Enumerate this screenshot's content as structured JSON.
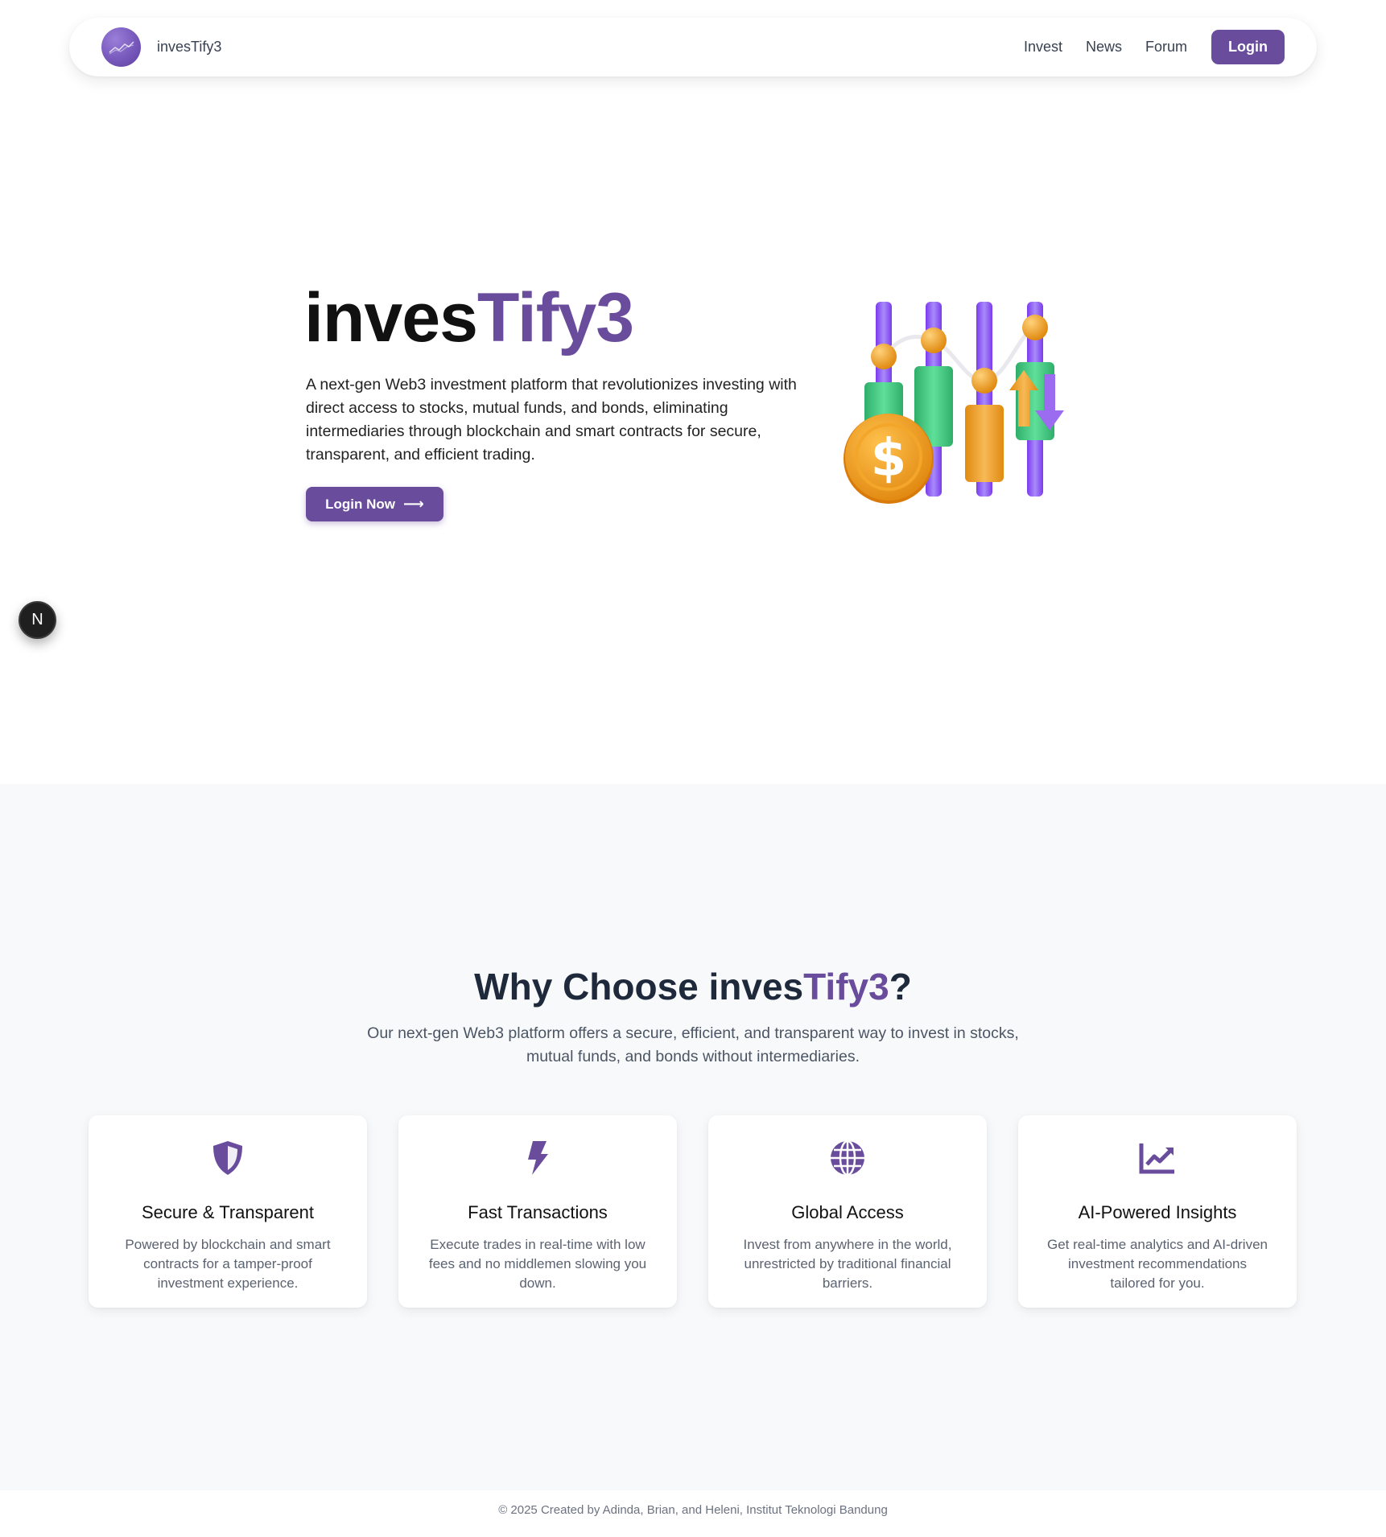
{
  "nav": {
    "brand": "invesTify3",
    "links": [
      "Invest",
      "News",
      "Forum"
    ],
    "login_label": "Login"
  },
  "hero": {
    "title_plain": "inves",
    "title_accent": "Tify3",
    "description": "A next-gen Web3 investment platform that revolutionizes investing with direct access to stocks, mutual funds, and bonds, eliminating intermediaries through blockchain and smart contracts for secure, transparent, and efficient trading.",
    "cta_label": "Login Now",
    "cta_icon": "arrow-right-icon",
    "illustration_icon": "stock-chart-coin-illustration"
  },
  "floating_badge": {
    "label": "N"
  },
  "features": {
    "title_bold": "Why Choose ",
    "title_plain": "inves",
    "title_accent": "Tify3",
    "title_end": "?",
    "subtitle": "Our next-gen Web3 platform offers a secure, efficient, and transparent way to invest in stocks, mutual funds, and bonds without intermediaries.",
    "cards": [
      {
        "icon": "shield-icon",
        "title": "Secure & Transparent",
        "description": "Powered by blockchain and smart contracts for a tamper-proof investment experience."
      },
      {
        "icon": "lightning-icon",
        "title": "Fast Transactions",
        "description": "Execute trades in real-time with low fees and no middlemen slowing you down."
      },
      {
        "icon": "globe-icon",
        "title": "Global Access",
        "description": "Invest from anywhere in the world, unrestricted by traditional financial barriers."
      },
      {
        "icon": "chart-line-icon",
        "title": "AI-Powered Insights",
        "description": "Get real-time analytics and AI-driven investment recommendations tailored for you."
      }
    ]
  },
  "footer": {
    "text": "© 2025 Created by Adinda, Brian, and Heleni, Institut Teknologi Bandung"
  },
  "colors": {
    "accent": "#6a4c9c",
    "section_bg": "#f8f9fb",
    "green": "#3dc47e",
    "orange": "#f0a22e",
    "purple_bar": "#8b5cf6"
  }
}
